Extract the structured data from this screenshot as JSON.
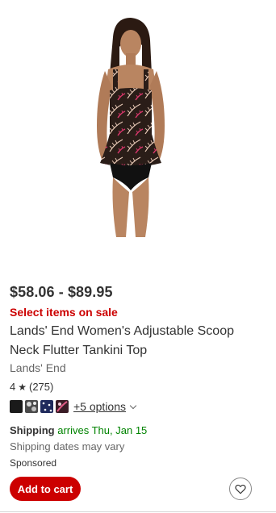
{
  "product": {
    "price": "$58.06 - $89.95",
    "sale_label": "Select items on sale",
    "title_line1": "Lands' End Women's Adjustable Scoop",
    "title_line2": "Neck Flutter Tankini Top",
    "brand": "Lands' End",
    "rating_value": "4",
    "rating_count": "(275)",
    "rating_stars": 4,
    "swatches": [
      {
        "name": "black",
        "color": "#1a1a1a"
      },
      {
        "name": "floral-gray",
        "color": "#9a9a9a"
      },
      {
        "name": "navy-dot",
        "color": "#1f2a5c"
      },
      {
        "name": "floral-pink",
        "color": "#7a2a45"
      }
    ],
    "more_options": "+5 options",
    "shipping_label": "Shipping",
    "shipping_arrival": "arrives Thu, Jan 15",
    "shipping_note": "Shipping dates may vary",
    "sponsored": "Sponsored",
    "add_to_cart": "Add to cart"
  },
  "colors": {
    "primary_red": "#cc0000",
    "shipping_green": "#008300",
    "text": "#333333",
    "muted": "#666666"
  },
  "icons": [
    "star-icon",
    "chevron-down-icon",
    "heart-icon"
  ]
}
